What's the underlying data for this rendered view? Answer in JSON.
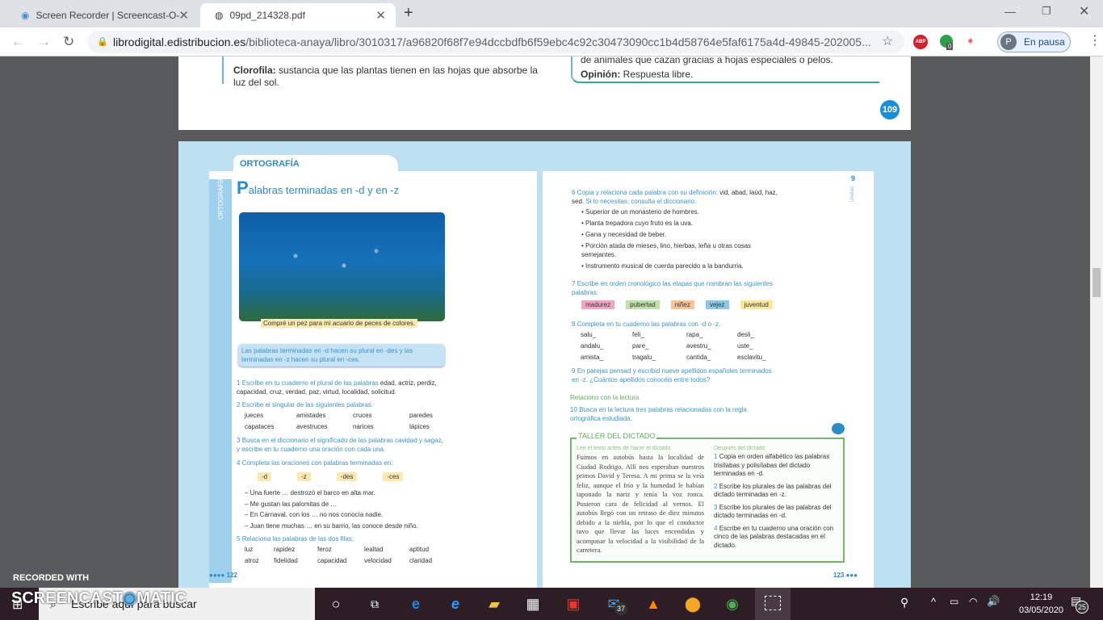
{
  "browser": {
    "tabs": [
      {
        "title": "Screen Recorder | Screencast-O-",
        "icon": "record-icon"
      },
      {
        "title": "09pd_214328.pdf",
        "icon": "globe-icon"
      }
    ],
    "url_host": "librodigital.edistribucion.es",
    "url_path": "/biblioteca-anaya/libro/3010317/a96820f68f7e94dccbdfb6f59ebc4c92c30473090cc1b4d58764e5faf6175a4d-49845-202005...",
    "profile_initial": "P",
    "profile_label": "En pausa",
    "ext_badge": "0",
    "abp": "ABP"
  },
  "page_prev": {
    "clorofila_term": "Clorofila:",
    "clorofila_def": "sustancia que las plantas tienen en las hojas que absorbe la luz del sol.",
    "animales": "de animales que cazan gracias a hojas especiales o pelos.",
    "opinion_term": "Opinión:",
    "opinion_def": "Respuesta libre.",
    "number": "109"
  },
  "left": {
    "section": "ORTOGRAFÍA",
    "side_label": "ORTOGRAFÍA",
    "title_initial": "P",
    "title": "alabras terminadas en -d y en -z",
    "caption": "Compré un pez para mi acuario de peces de colores.",
    "rule": "Las palabras terminadas en -d hacen su plural en -des y las terminadas en -z hacen su plural en -ces.",
    "ex1_n": "1",
    "ex1_a": "Escribe en tu cuaderno el plural de las palabras",
    "ex1_b": "edad, actriz, perdiz, capacidad, cruz, verdad, paz, virtud, localidad, solicitud.",
    "ex2_n": "2",
    "ex2": "Escribe el singular de las siguientes palabras:",
    "ex2_words": [
      "jueces",
      "amistades",
      "cruces",
      "paredes",
      "capataces",
      "avestruces",
      "narices",
      "lápices"
    ],
    "ex3_n": "3",
    "ex3": "Busca en el diccionario el significado de las palabras cavidad y sagaz, y escribe en tu cuaderno una oración con cada una.",
    "ex4_n": "4",
    "ex4": "Completa las oraciones con palabras terminadas en:",
    "ex4_tags": [
      "-d",
      "-z",
      "-des",
      "-ces"
    ],
    "ex4_lines": [
      "– Una fuerte … destrozó el barco en alta mar.",
      "– Me gustan las palomitas de …",
      "– En Carnaval, con los … no nos conocía nadie.",
      "– Juan tiene muchas … en su barrio, las conoce desde niño."
    ],
    "ex5_n": "5",
    "ex5": "Relaciona las palabras de las dos filas:",
    "ex5_words": [
      "luz",
      "rapidez",
      "feroz",
      "lealtad",
      "aptitud",
      "atroz",
      "fidelidad",
      "capacidad",
      "velocidad",
      "claridad"
    ],
    "page_number": "122"
  },
  "right": {
    "unit": "9",
    "unit_label": "Unidad",
    "ex6_n": "6",
    "ex6_a": "Copia y relaciona cada palabra con su definición:",
    "ex6_b": "vid, abad, laúd, haz, sed.",
    "ex6_c": "Si lo necesitas, consulta el diccionario.",
    "ex6_items": [
      "Superior de un monasterio de hombres.",
      "Planta trepadora cuyo fruto es la uva.",
      "Gana y necesidad de beber.",
      "Porción atada de mieses, lino, hierbas, leña u otras cosas semejantes.",
      "Instrumento musical de cuerda parecido a la bandurria."
    ],
    "ex7_n": "7",
    "ex7": "Escribe en orden cronológico las etapas que nombran las siguientes palabras:",
    "ex7_tags": [
      {
        "text": "madurez",
        "color": "#f2a6c4"
      },
      {
        "text": "pubertad",
        "color": "#bfe0a8"
      },
      {
        "text": "niñez",
        "color": "#f7c49a"
      },
      {
        "text": "vejez",
        "color": "#8cc8ea"
      },
      {
        "text": "juventud",
        "color": "#fbe79a"
      }
    ],
    "ex8_n": "8",
    "ex8": "Completa en tu cuaderno las palabras con -d o -z:",
    "ex8_words": [
      "salu_",
      "feli_",
      "rapa_",
      "desli_",
      "andalu_",
      "pare_",
      "avestru_",
      "uste_",
      "amista_",
      "tragalu_",
      "cantida_",
      "esclavitu_"
    ],
    "ex9_n": "9",
    "ex9": "En parejas pensad y escribid nueve apellidos españoles terminados en -z. ¿Cuántos apellidos conocéis entre todos?",
    "reading_heading": "Relaciono con la lectura",
    "ex10_n": "10",
    "ex10": "Busca en la lectura tres palabras relacionadas con la regla ortográfica estudiada.",
    "taller_title": "TALLER DEL DICTADO",
    "before": "Lee el texto antes de hacer el dictado",
    "after": "Después del dictado",
    "dictation": "Fuimos en autobús hasta la localidad de Ciudad Rodrigo. Allí nos esperaban nuestros primos David y Teresa. A mi prima se la veía feliz, aunque el frío y la humedad le habían taponado la nariz y tenía la voz ronca. Pusieron cara de felicidad al vernos. El autobús llegó con un retraso de diez minutos debido a la niebla, por lo que el conductor tuvo que llevar las luces encendidas y acompasar la velocidad a la visibilidad de la carretera.",
    "after_items": [
      {
        "n": "1",
        "text": "Copia en orden alfabético las palabras trisílabas y polisílabas del dictado terminadas en -d."
      },
      {
        "n": "2",
        "text": "Escribe los plurales de las palabras del dictado terminadas en -z."
      },
      {
        "n": "3",
        "text": "Escribe los plurales de las palabras del dictado terminadas en -d."
      },
      {
        "n": "4",
        "text": "Escribe en tu cuaderno una oración con cinco de las palabras destacadas en el dictado."
      }
    ],
    "page_number": "123"
  },
  "watermark": {
    "line1": "RECORDED WITH",
    "line2": "SCREENCAST",
    "line3": "MATIC"
  },
  "taskbar": {
    "search_placeholder": "Escribe aquí para buscar",
    "mail_badge": "37",
    "time": "12:19",
    "date": "03/05/2020",
    "notif_count": "25"
  },
  "colors": {
    "accent": "#3d94c6",
    "taller_green": "#5fae5a",
    "page_bg": "#bde0f3"
  }
}
